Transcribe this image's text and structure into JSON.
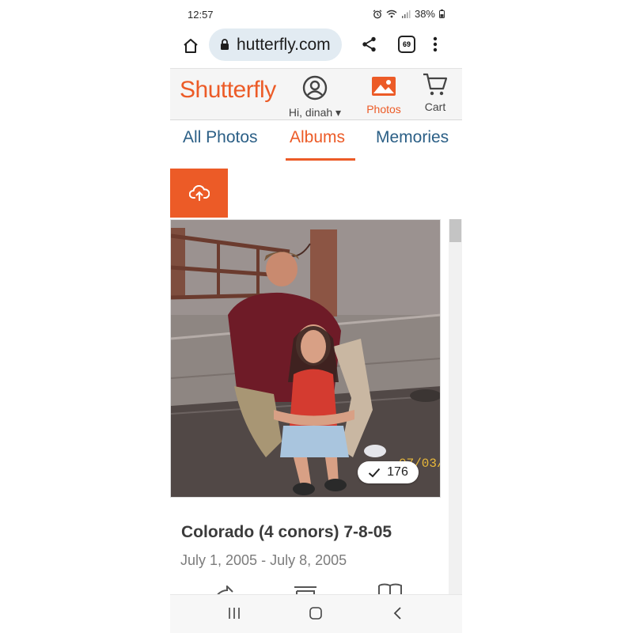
{
  "status_bar": {
    "time": "12:57",
    "battery": "38%"
  },
  "browser": {
    "url": "hutterfly.com",
    "tab_count": "69"
  },
  "app": {
    "logo": "Shutterfly",
    "account_label": "Hi, dinah ▾",
    "photos_label": "Photos",
    "cart_label": "Cart",
    "accent_color": "#ec5b27",
    "link_color": "#2b5f86"
  },
  "tabs": [
    {
      "label": "All Photos",
      "active": false
    },
    {
      "label": "Albums",
      "active": true
    },
    {
      "label": "Memories",
      "active": false
    }
  ],
  "album": {
    "title": "Colorado (4 conors) 7-8-05",
    "dates": "July 1, 2005 - July 8, 2005",
    "photo_count": "176",
    "photo_date_stamp": "07/03/"
  },
  "icons": {
    "home": "home-icon",
    "lock": "lock-icon",
    "share": "share-icon",
    "tabs": "tab-switcher-icon",
    "menu": "more-vertical-icon",
    "account": "account-icon",
    "photos": "photo-icon",
    "cart": "cart-icon",
    "upload": "cloud-upload-icon",
    "check": "check-icon",
    "recents": "recents-icon",
    "home_nav": "home-nav-icon",
    "back": "back-icon"
  }
}
